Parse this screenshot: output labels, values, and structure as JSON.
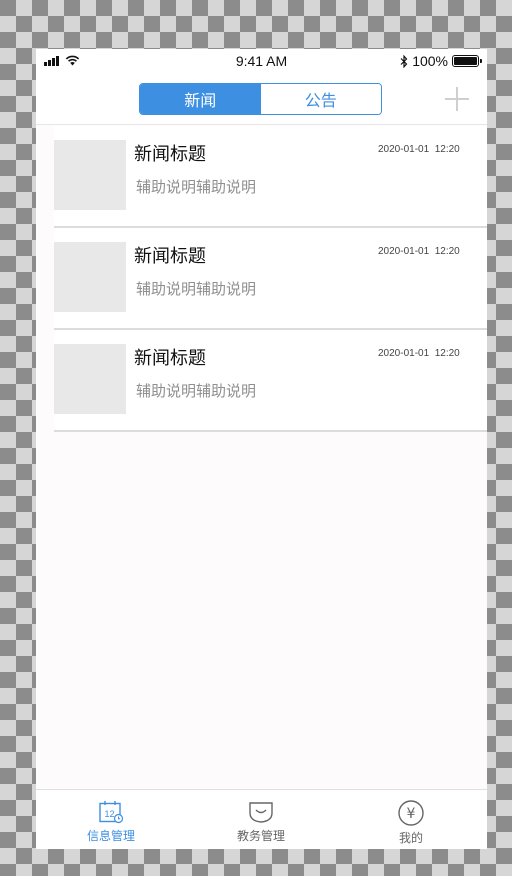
{
  "status_bar": {
    "time": "9:41 AM",
    "battery_text": "100%",
    "battery_level": 1.0
  },
  "header": {
    "tabs": [
      {
        "label": "新闻",
        "active": true
      },
      {
        "label": "公告",
        "active": false
      }
    ],
    "add_icon": "plus-icon"
  },
  "news_items": [
    {
      "title": "新闻标题",
      "subtitle": "辅助说明辅助说明",
      "date": "2020-01-01  12:20"
    },
    {
      "title": "新闻标题",
      "subtitle": "辅助说明辅助说明",
      "date": "2020-01-01  12:20"
    },
    {
      "title": "新闻标题",
      "subtitle": "辅助说明辅助说明",
      "date": "2020-01-01  12:20"
    }
  ],
  "tabbar": {
    "items": [
      {
        "label": "信息管理",
        "icon": "calendar-icon",
        "badge": "12",
        "active": true
      },
      {
        "label": "教务管理",
        "icon": "tray-icon",
        "active": false
      },
      {
        "label": "我的",
        "icon": "yen-circle-icon",
        "symbol": "¥",
        "active": false
      }
    ]
  },
  "colors": {
    "accent": "#3d8fe2",
    "thumbnail": "#e8e8e8",
    "subtitle": "#8f8f8f"
  }
}
